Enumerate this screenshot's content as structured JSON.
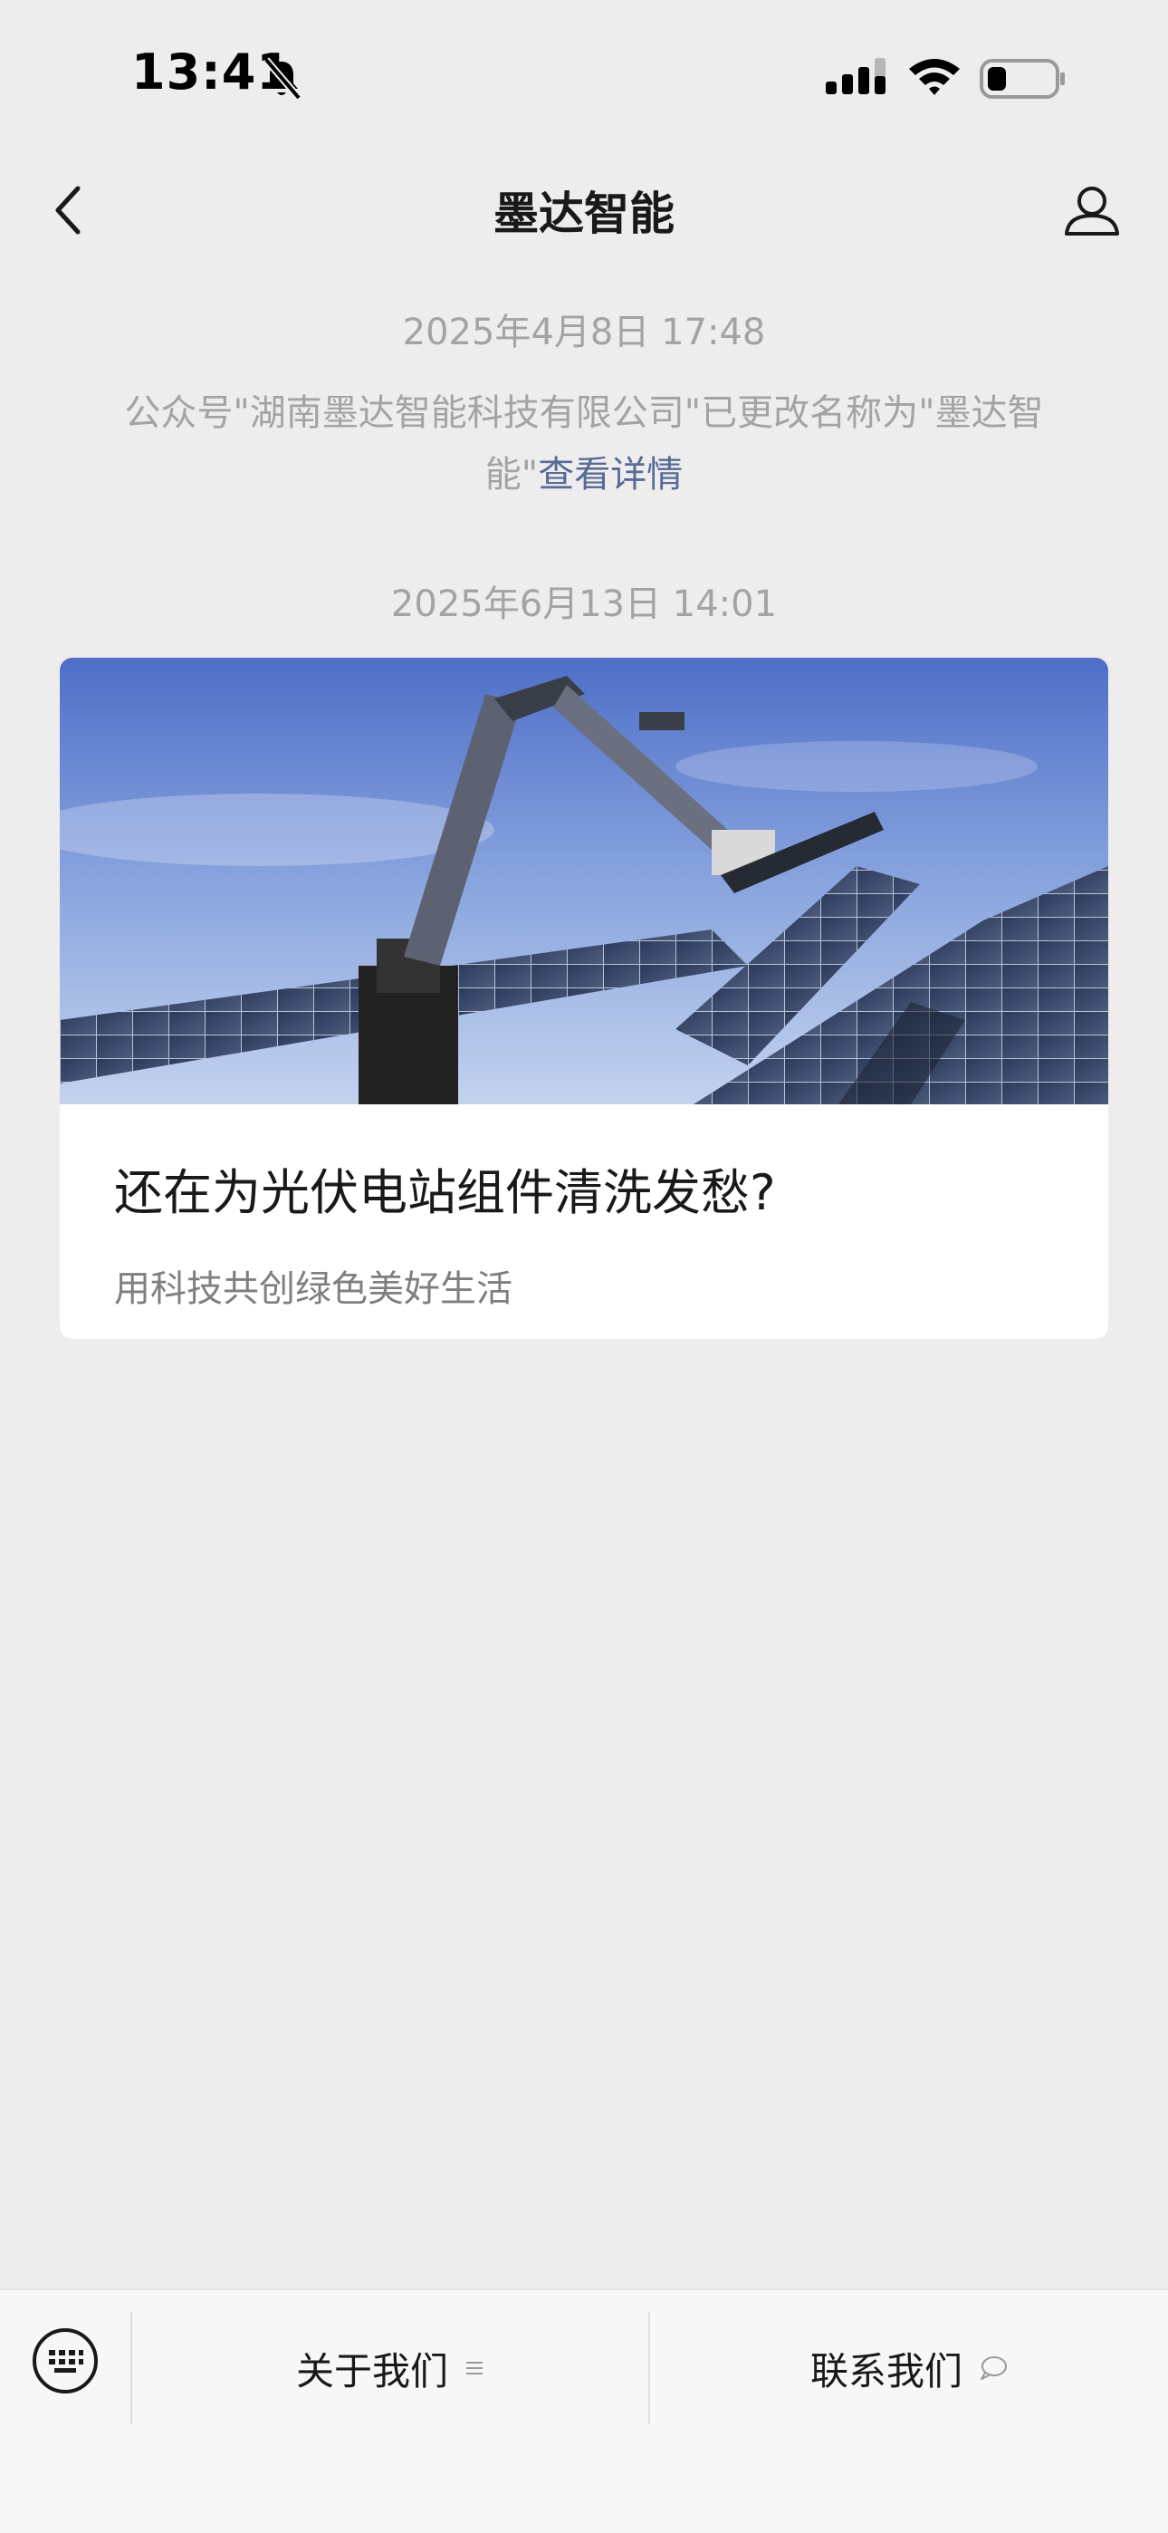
{
  "status_bar": {
    "time": "13:41",
    "icons": [
      "bell-muted-icon",
      "cellular-signal-icon",
      "wifi-icon",
      "battery-icon"
    ]
  },
  "nav": {
    "title": "墨达智能",
    "back_icon": "chevron-left-icon",
    "profile_icon": "person-icon"
  },
  "messages": [
    {
      "timestamp": "2025年4月8日 17:48",
      "notice_text": "公众号\"湖南墨达智能科技有限公司\"已更改名称为\"墨达智能\"",
      "notice_link": "查看详情"
    },
    {
      "timestamp": "2025年6月13日 14:01",
      "article": {
        "title": "还在为光伏电站组件清洗发愁?",
        "subtitle": "用科技共创绿色美好生活",
        "cover_image": "solar-panel-cleaning-robot-photo"
      }
    }
  ],
  "bottom_menu": {
    "keyboard_icon": "keyboard-icon",
    "items": [
      {
        "label": "关于我们",
        "icon": "menu-lines-icon"
      },
      {
        "label": "联系我们",
        "icon": "chat-bubble-icon"
      }
    ]
  },
  "colors": {
    "background": "#ededed",
    "link": "#576b95",
    "meta_text": "#a3a3a3",
    "card": "#ffffff",
    "bottom_bar": "#f7f7f7"
  }
}
